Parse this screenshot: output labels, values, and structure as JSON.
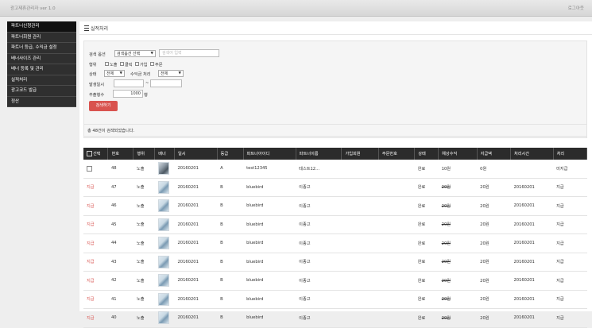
{
  "app": {
    "title": "광고제휴관리자 ver 1.0",
    "logout": "로그아웃"
  },
  "sidebar": {
    "items": [
      {
        "label": "파트너신청관리"
      },
      {
        "label": "파트너회원 관리"
      },
      {
        "label": "파트너 등급, 수익금 설정"
      },
      {
        "label": "배너사이즈 관리"
      },
      {
        "label": "배너 등록 및 관리"
      },
      {
        "label": "실적처리"
      },
      {
        "label": "광고코드 발급"
      },
      {
        "label": "정산"
      }
    ]
  },
  "panel": {
    "title": "실적처리"
  },
  "search": {
    "field_label": "검색 옵션",
    "field_select": "검색옵션 선택",
    "keyword_placeholder": "검색어 입력",
    "type_label": "형위",
    "type_options": [
      "노출",
      "클릭",
      "가입",
      "주문"
    ],
    "status_label": "상태",
    "status_select": "전체",
    "profit_label": "수익금 처리",
    "profit_select": "전체",
    "date_label": "발생일시",
    "date_sep": "~",
    "count_label": "추출행수",
    "count_value": "1000",
    "count_unit": "행",
    "submit_label": "검색하기"
  },
  "result": {
    "summary": "총 48건이 검색되었습니다."
  },
  "table": {
    "headers": [
      "선택",
      "번호",
      "행위",
      "배너",
      "일시",
      "등급",
      "파트너아이디",
      "파트너이름",
      "가입회원",
      "주문번호",
      "상태",
      "예상수익",
      "지급액",
      "처리시간",
      "처리"
    ],
    "rows": [
      {
        "select": "",
        "checkbox": true,
        "no": "48",
        "action": "노출",
        "date": "20160201",
        "grade": "A",
        "partner_id": "test12345",
        "partner_name": "테스트12...",
        "member": "",
        "order": "",
        "status": "완료",
        "expected": "10원",
        "expected_strike": false,
        "paid": "0원",
        "time": "",
        "process": "미지급",
        "thumb": "dark"
      },
      {
        "select": "지급",
        "checkbox": false,
        "no": "47",
        "action": "노출",
        "date": "20160201",
        "grade": "B",
        "partner_id": "bluebird",
        "partner_name": "이종고",
        "member": "",
        "order": "",
        "status": "완료",
        "expected": "20원",
        "expected_strike": true,
        "paid": "20원",
        "time": "20160201",
        "process": "지급",
        "thumb": "light"
      },
      {
        "select": "지급",
        "checkbox": false,
        "no": "46",
        "action": "노출",
        "date": "20160201",
        "grade": "B",
        "partner_id": "bluebird",
        "partner_name": "이종고",
        "member": "",
        "order": "",
        "status": "완료",
        "expected": "20원",
        "expected_strike": true,
        "paid": "20원",
        "time": "20160201",
        "process": "지급",
        "thumb": "light"
      },
      {
        "select": "지급",
        "checkbox": false,
        "no": "45",
        "action": "노출",
        "date": "20160201",
        "grade": "B",
        "partner_id": "bluebird",
        "partner_name": "이종고",
        "member": "",
        "order": "",
        "status": "완료",
        "expected": "20원",
        "expected_strike": true,
        "paid": "20원",
        "time": "20160201",
        "process": "지급",
        "thumb": "light"
      },
      {
        "select": "지급",
        "checkbox": false,
        "no": "44",
        "action": "노출",
        "date": "20160201",
        "grade": "B",
        "partner_id": "bluebird",
        "partner_name": "이종고",
        "member": "",
        "order": "",
        "status": "완료",
        "expected": "20원",
        "expected_strike": true,
        "paid": "20원",
        "time": "20160201",
        "process": "지급",
        "thumb": "light"
      },
      {
        "select": "지급",
        "checkbox": false,
        "no": "43",
        "action": "노출",
        "date": "20160201",
        "grade": "B",
        "partner_id": "bluebird",
        "partner_name": "이종고",
        "member": "",
        "order": "",
        "status": "완료",
        "expected": "20원",
        "expected_strike": true,
        "paid": "20원",
        "time": "20160201",
        "process": "지급",
        "thumb": "light"
      },
      {
        "select": "지급",
        "checkbox": false,
        "no": "42",
        "action": "노출",
        "date": "20160201",
        "grade": "B",
        "partner_id": "bluebird",
        "partner_name": "이종고",
        "member": "",
        "order": "",
        "status": "완료",
        "expected": "20원",
        "expected_strike": true,
        "paid": "20원",
        "time": "20160201",
        "process": "지급",
        "thumb": "light"
      },
      {
        "select": "지급",
        "checkbox": false,
        "no": "41",
        "action": "노출",
        "date": "20160201",
        "grade": "B",
        "partner_id": "bluebird",
        "partner_name": "이종고",
        "member": "",
        "order": "",
        "status": "완료",
        "expected": "20원",
        "expected_strike": true,
        "paid": "20원",
        "time": "20160201",
        "process": "지급",
        "thumb": "light"
      },
      {
        "select": "지급",
        "checkbox": false,
        "no": "40",
        "action": "노출",
        "date": "20160201",
        "grade": "B",
        "partner_id": "bluebird",
        "partner_name": "이종고",
        "member": "",
        "order": "",
        "status": "완료",
        "expected": "20원",
        "expected_strike": true,
        "paid": "20원",
        "time": "20160201",
        "process": "지급",
        "thumb": "light"
      }
    ]
  },
  "colors": {
    "accent_red": "#d9534f",
    "header_dark": "#2b2b2b",
    "sidebar": "#2f2f2f"
  }
}
